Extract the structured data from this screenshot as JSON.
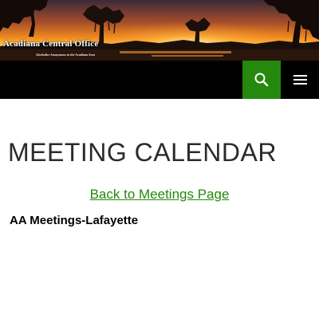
{
  "header": {
    "site_title": "Acadiana Central Office",
    "tagline": "Alcoholics Anonymous in the Acadiana Area",
    "banner_image": "sunset-over-cypress-swamp"
  },
  "nav": {
    "search_icon": "search-icon",
    "menu_icon": "hamburger-menu-icon",
    "accent_color": "#24890d",
    "bar_color": "#000000"
  },
  "main": {
    "page_title": "MEETING CALENDAR",
    "back_link": "Back to Meetings Page",
    "section_heading": "AA Meetings-Lafayette"
  }
}
